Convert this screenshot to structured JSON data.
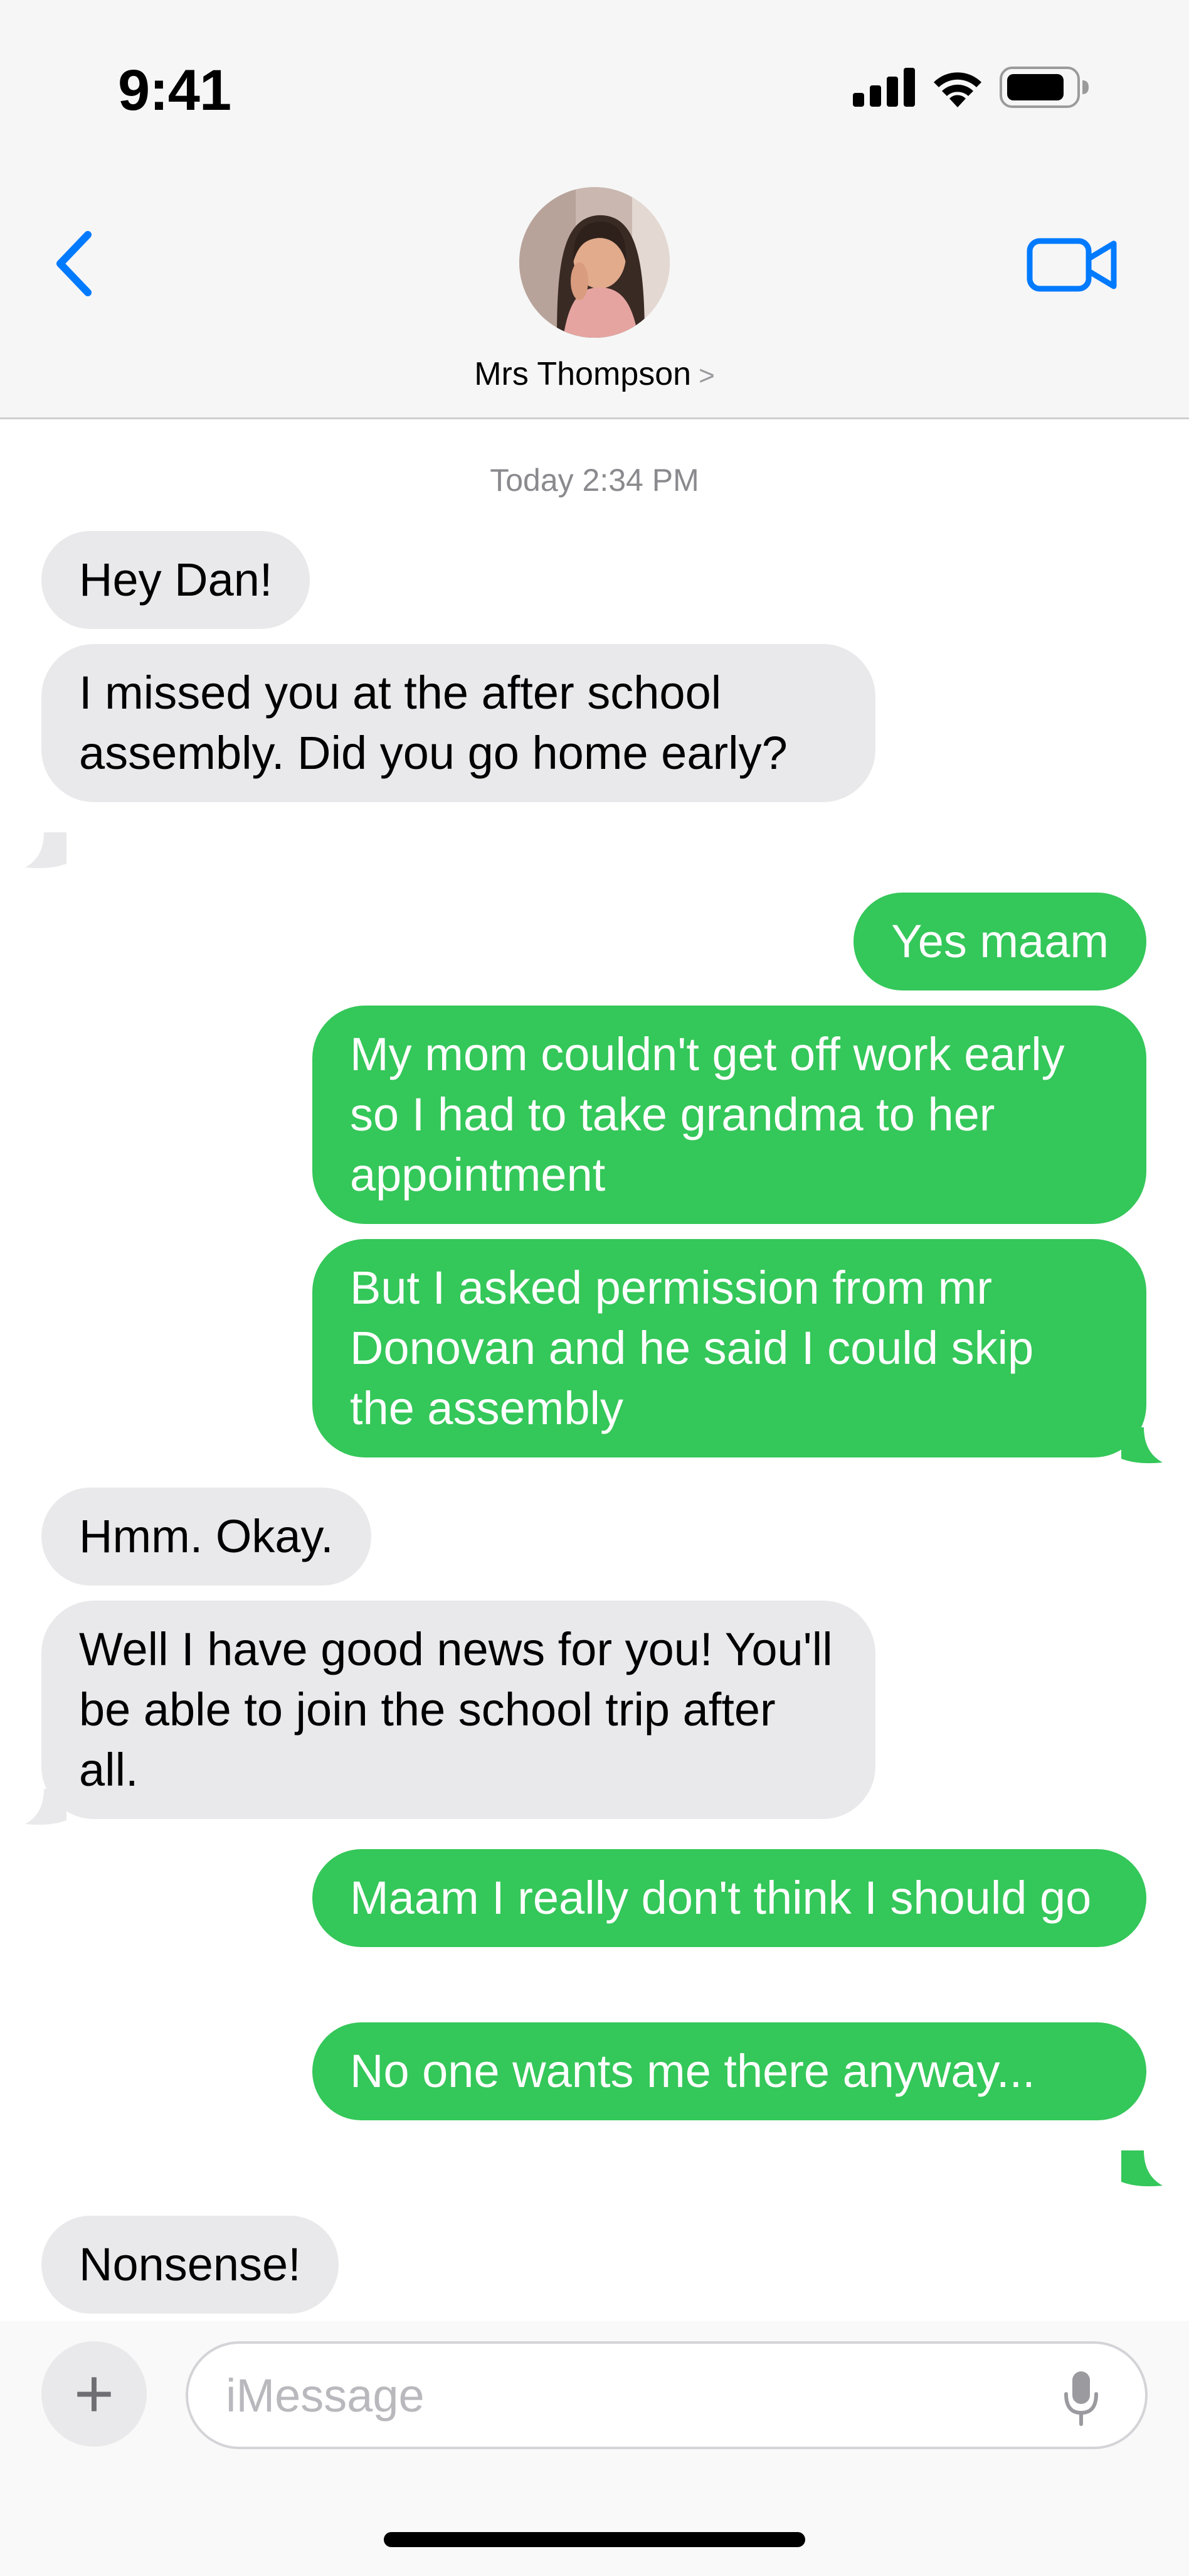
{
  "status_bar": {
    "time": "9:41",
    "icons": [
      "cellular-signal-icon",
      "wifi-icon",
      "battery-icon"
    ]
  },
  "header": {
    "back_icon": "chevron-left-icon",
    "contact_name": "Mrs Thompson",
    "contact_chevron": ">",
    "video_icon": "video-camera-icon"
  },
  "thread": {
    "timestamp": "Today 2:34 PM",
    "messages": [
      {
        "direction": "incoming",
        "text": "Hey Dan!"
      },
      {
        "direction": "incoming",
        "text": "I missed you at the after school assembly. Did you go home early?"
      },
      {
        "direction": "outgoing",
        "text": "Yes maam"
      },
      {
        "direction": "outgoing",
        "text": "My mom couldn't get off work early so I had to take grandma to her appointment"
      },
      {
        "direction": "outgoing",
        "text": "But I asked permission from mr Donovan and he said I could skip the assembly"
      },
      {
        "direction": "incoming",
        "text": "Hmm. Okay."
      },
      {
        "direction": "incoming",
        "text": "Well I have good news for you! You'll be able to join the school trip after all."
      },
      {
        "direction": "outgoing",
        "text": "Maam I really don't think I should go"
      },
      {
        "direction": "outgoing",
        "text": "No one wants me there anyway..."
      },
      {
        "direction": "incoming",
        "text": "Nonsense!"
      }
    ]
  },
  "composer": {
    "plus_label": "+",
    "placeholder": "iMessage",
    "mic_icon": "microphone-icon"
  },
  "colors": {
    "incoming_bubble": "#e9e9eb",
    "outgoing_bubble": "#34c759",
    "accent": "#007aff",
    "header_bg": "#f6f6f6"
  }
}
